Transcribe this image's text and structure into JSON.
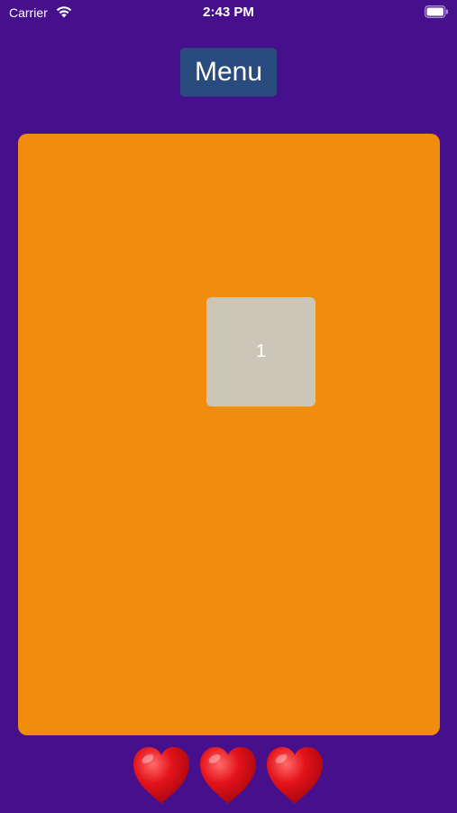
{
  "status_bar": {
    "carrier": "Carrier",
    "time": "2:43 PM",
    "wifi_icon": "wifi-icon",
    "battery_icon": "battery-icon"
  },
  "menu": {
    "label": "Menu"
  },
  "board": {
    "tile_value": "1"
  },
  "lives": {
    "count": 3,
    "icon": "heart-icon"
  },
  "colors": {
    "background": "#46108c",
    "menu_button": "#294b7d",
    "board": "#f28c0c",
    "tile": "#ccc6b8",
    "heart": "#e3131b"
  }
}
